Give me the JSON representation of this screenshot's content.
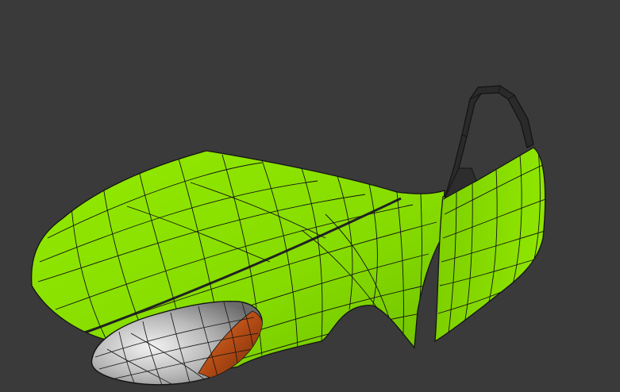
{
  "viewport": {
    "background": "#3a3a3a",
    "mesh_color": "#8fe600",
    "mesh_shade": "#6fbf00",
    "wire_color": "#141414",
    "trim_color": "#2a2a2a",
    "headlight_chrome": "#c9c9c9",
    "headlight_amber": "#b24a14"
  },
  "model": {
    "parts": [
      "hood",
      "fender",
      "door",
      "door-window-frame",
      "headlight"
    ]
  }
}
